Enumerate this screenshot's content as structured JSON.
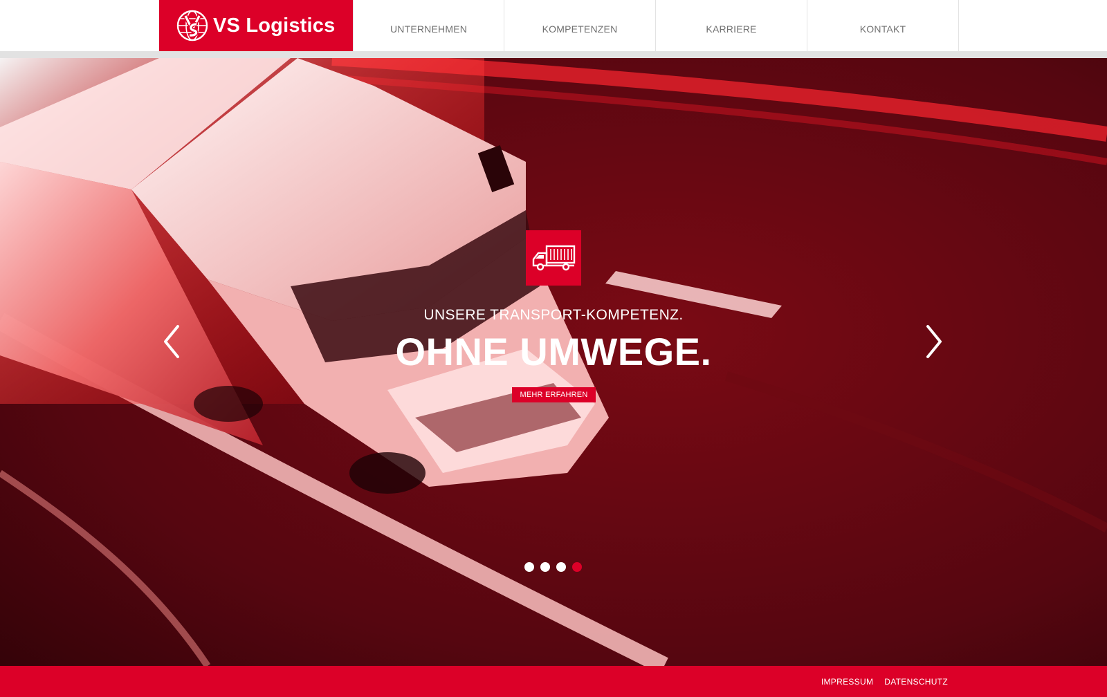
{
  "brand": {
    "name": "VS Logistics",
    "accent_color": "#dc0028",
    "logo_icon": "globe-vs-monogram-icon"
  },
  "nav": {
    "items": [
      {
        "label": "UNTERNEHMEN"
      },
      {
        "label": "KOMPETENZEN"
      },
      {
        "label": "KARRIERE"
      },
      {
        "label": "KONTAKT"
      }
    ]
  },
  "hero": {
    "badge_icon": "truck-icon",
    "subtitle": "UNSERE TRANSPORT-KOMPETENZ.",
    "title": "OHNE UMWEGE.",
    "cta_label": "MEHR ERFAHREN",
    "background_image": "red-tinted-truck-on-highway",
    "prev_icon": "chevron-left-icon",
    "next_icon": "chevron-right-icon",
    "slides_total": 4,
    "active_slide": 4
  },
  "footer": {
    "links": [
      {
        "label": "IMPRESSUM"
      },
      {
        "label": "DATENSCHUTZ"
      }
    ]
  }
}
